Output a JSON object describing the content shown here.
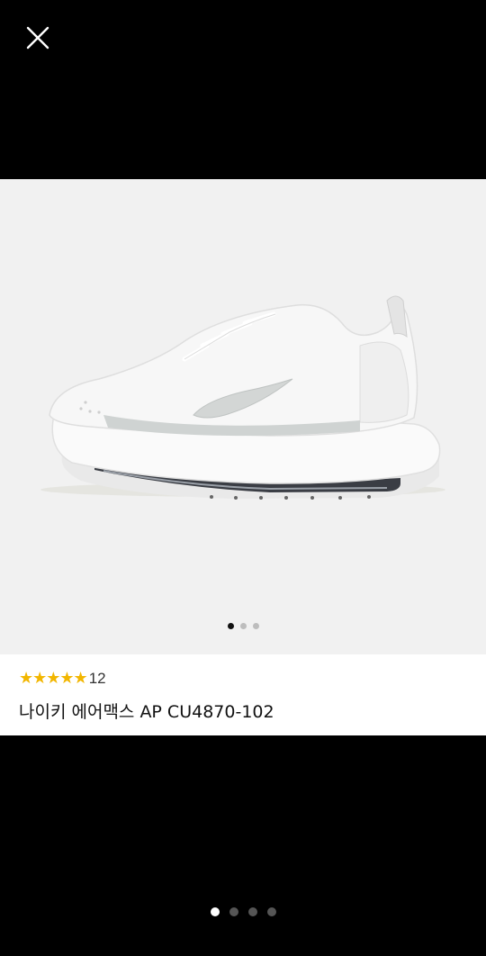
{
  "viewer": {
    "close_icon": "close-icon"
  },
  "product": {
    "image_icon": "sneaker-image",
    "image_dots": {
      "count": 3,
      "active": 0
    },
    "rating": {
      "stars": 5,
      "stars_text": "★★★★★",
      "count": "12"
    },
    "title": "나이키 에어맥스 AP CU4870-102"
  },
  "pager": {
    "count": 4,
    "active": 0
  },
  "colors": {
    "background": "#000000",
    "star": "#f2b600",
    "image_bg": "#f1f1f1"
  }
}
